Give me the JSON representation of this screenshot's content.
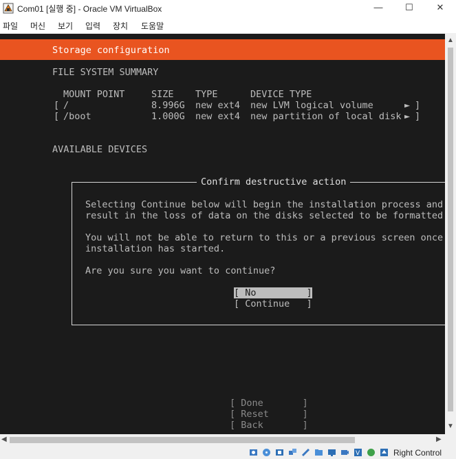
{
  "window": {
    "title": "Com01 [실행 중] - Oracle VM VirtualBox",
    "controls": {
      "minimize": "—",
      "maximize": "☐",
      "close": "✕"
    }
  },
  "menu": [
    "파일",
    "머신",
    "보기",
    "입력",
    "장치",
    "도움말"
  ],
  "installer": {
    "header": "Storage configuration",
    "fs_summary_title": "FILE SYSTEM SUMMARY",
    "columns": [
      "MOUNT POINT",
      "SIZE",
      "TYPE",
      "DEVICE TYPE"
    ],
    "rows": [
      {
        "open": "[",
        "mount": "/",
        "size": "8.996G",
        "type": "new ext4",
        "device": "new LVM logical volume",
        "arrow": "►",
        "close": "]"
      },
      {
        "open": "[",
        "mount": "/boot",
        "size": "1.000G",
        "type": "new ext4",
        "device": "new partition of local disk",
        "arrow": "►",
        "close": "]"
      }
    ],
    "available_title": "AVAILABLE DEVICES",
    "dialog": {
      "title": "Confirm destructive action",
      "line1": "Selecting Continue below will begin the installation process and",
      "line2": "result in the loss of data on the disks selected to be formatted.",
      "line3": "You will not be able to return to this or a previous screen once t",
      "line4": "installation has started.",
      "question": "Are you sure you want to continue?",
      "btn_no": "[ No         ]",
      "btn_continue": "[ Continue   ]"
    },
    "bottom_buttons": {
      "done": "[ Done       ]",
      "reset": "[ Reset      ]",
      "back": "[ Back       ]"
    }
  },
  "statusbar": {
    "host_key": "Right Control"
  },
  "colors": {
    "accent": "#e95420",
    "terminal_bg": "#1b1b1b"
  }
}
